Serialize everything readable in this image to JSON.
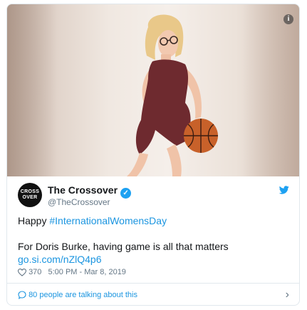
{
  "media": {
    "badge_label": "i"
  },
  "user": {
    "avatar_text": "CROSS OVER",
    "name": "The Crossover",
    "handle": "@TheCrossover"
  },
  "tweet": {
    "line1_prefix": "Happy ",
    "hashtag": "#InternationalWomensDay",
    "line2": "For Doris Burke, having game is all that matters",
    "link": "go.si.com/nZlQ4p6"
  },
  "meta": {
    "likes": "370",
    "timestamp": "5:00 PM - Mar 8, 2019"
  },
  "footer": {
    "talking": "80 people are talking about this"
  },
  "colors": {
    "link": "#1b95e0",
    "verified": "#1da1f2",
    "muted": "#657786",
    "dress": "#6e2a2f",
    "ball": "#c8612a"
  }
}
